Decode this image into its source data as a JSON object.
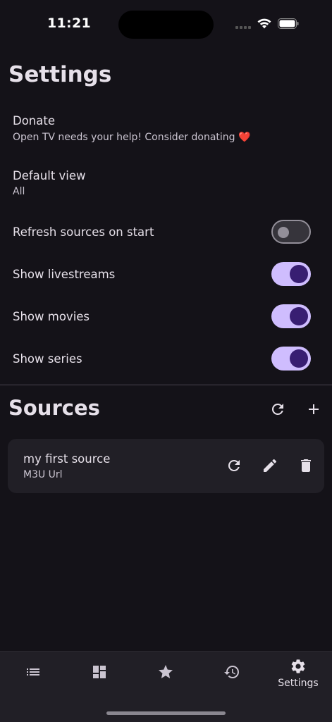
{
  "status": {
    "time": "11:21"
  },
  "settings": {
    "title": "Settings",
    "donate": {
      "title": "Donate",
      "subtitle": "Open TV needs your help! Consider donating ❤️"
    },
    "default_view": {
      "title": "Default view",
      "value": "All"
    },
    "toggles": [
      {
        "label": "Refresh sources on start",
        "on": false
      },
      {
        "label": "Show livestreams",
        "on": true
      },
      {
        "label": "Show movies",
        "on": true
      },
      {
        "label": "Show series",
        "on": true
      }
    ]
  },
  "sources": {
    "title": "Sources",
    "items": [
      {
        "name": "my first source",
        "type": "M3U Url"
      }
    ]
  },
  "nav": {
    "items": [
      {
        "icon": "list-icon",
        "label": ""
      },
      {
        "icon": "dashboard-icon",
        "label": ""
      },
      {
        "icon": "star-icon",
        "label": ""
      },
      {
        "icon": "history-icon",
        "label": ""
      },
      {
        "icon": "gear-icon",
        "label": "Settings"
      }
    ]
  },
  "colors": {
    "background": "#141218",
    "accent": "#cfbdfe",
    "accent_dark": "#381e72",
    "card": "#211f26"
  }
}
